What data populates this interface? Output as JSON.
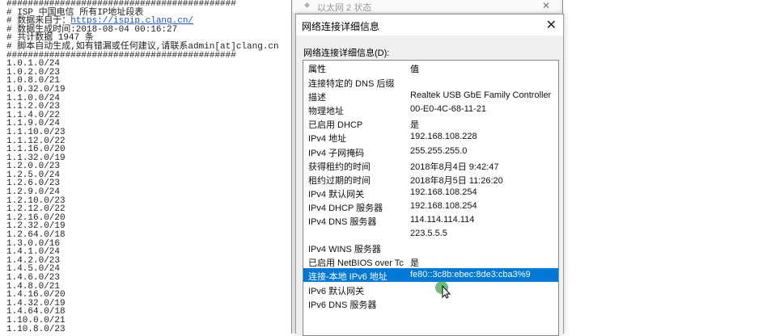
{
  "textfile": {
    "lines": [
      "###########################################",
      "# ISP 中国电信 所有IP地址段表",
      "# 数据来自于：",
      "# 数据生成时间:2018-08-04 00:16:27",
      "# 共计数据 1947 条",
      "# 脚本自动生成,如有错漏或任何建议,请联系admin[at]clang.cn",
      "###########################################",
      "1.0.1.0/24",
      "1.0.2.0/23",
      "1.0.8.0/21",
      "1.0.32.0/19",
      "1.1.0.0/24",
      "1.1.2.0/23",
      "1.1.4.0/22",
      "1.1.9.0/24",
      "1.1.10.0/23",
      "1.1.12.0/22",
      "1.1.16.0/20",
      "1.1.32.0/19",
      "1.2.0.0/23",
      "1.2.5.0/24",
      "1.2.6.0/23",
      "1.2.9.0/24",
      "1.2.10.0/23",
      "1.2.12.0/22",
      "1.2.16.0/20",
      "1.2.32.0/19",
      "1.2.64.0/18",
      "1.3.0.0/16",
      "1.4.1.0/24",
      "1.4.2.0/23",
      "1.4.5.0/24",
      "1.4.6.0/23",
      "1.4.8.0/21",
      "1.4.16.0/20",
      "1.4.32.0/19",
      "1.4.64.0/18",
      "1.10.0.0/21",
      "1.10.8.0/23"
    ],
    "source_link": "https://ispip.clang.cn/"
  },
  "status_window": {
    "title": "以太网 2 状态",
    "close": "✕"
  },
  "dialog": {
    "title": "网络连接详细信息",
    "close": "✕",
    "detail_label": "网络连接详细信息(D):",
    "header": {
      "property": "属性",
      "value": "值"
    },
    "rows": [
      {
        "property": "连接特定的 DNS 后缀",
        "value": ""
      },
      {
        "property": "描述",
        "value": "Realtek USB GbE Family Controller"
      },
      {
        "property": "物理地址",
        "value": "00-E0-4C-68-11-21"
      },
      {
        "property": "已启用 DHCP",
        "value": "是"
      },
      {
        "property": "IPv4 地址",
        "value": "192.168.108.228"
      },
      {
        "property": "IPv4 子网掩码",
        "value": "255.255.255.0"
      },
      {
        "property": "获得租约的时间",
        "value": "2018年8月4日 9:42:47"
      },
      {
        "property": "租约过期的时间",
        "value": "2018年8月5日 11:26:20"
      },
      {
        "property": "IPv4 默认网关",
        "value": "192.168.108.254"
      },
      {
        "property": "IPv4 DHCP 服务器",
        "value": "192.168.108.254"
      },
      {
        "property": "IPv4 DNS 服务器",
        "value": "114.114.114.114"
      },
      {
        "property": "",
        "value": "223.5.5.5"
      },
      {
        "property": "IPv4 WINS 服务器",
        "value": ""
      },
      {
        "property": "已启用 NetBIOS over Tc",
        "value": "是"
      },
      {
        "property": "连接-本地 IPv6 地址",
        "value": "fe80::3c8b:ebec:8de3:cba3%9",
        "selected": true
      },
      {
        "property": "IPv6 默认网关",
        "value": ""
      },
      {
        "property": "IPv6 DNS 服务器",
        "value": ""
      }
    ]
  },
  "colors": {
    "selection": "#0078d7",
    "link": "#1a56c9"
  }
}
